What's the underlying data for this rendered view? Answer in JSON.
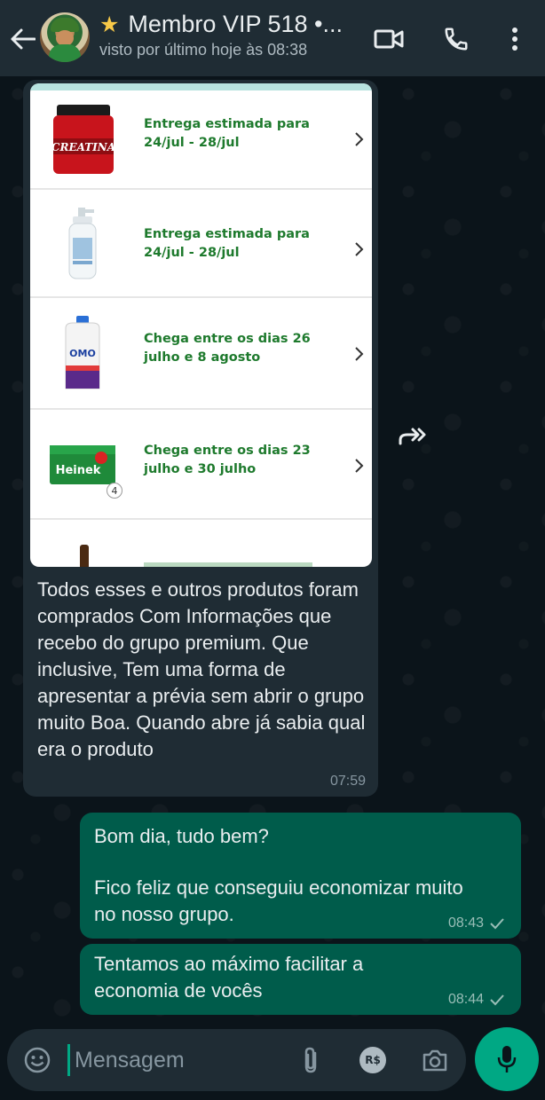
{
  "header": {
    "title": "Membro VIP 518 •...",
    "title_icon": "star-icon",
    "last_seen": "visto por último hoje às 08:38",
    "icons": [
      "back-arrow-icon",
      "video-call-icon",
      "phone-call-icon",
      "more-vert-icon"
    ]
  },
  "chat": {
    "incoming": {
      "products": [
        {
          "thumb": "creatina-product-icon",
          "thumb_label": "CREATINA",
          "text": "Entrega estimada para 24/jul - 28/jul"
        },
        {
          "thumb": "lotion-bottle-icon",
          "thumb_label": "",
          "text": "Entrega estimada para 24/jul - 28/jul"
        },
        {
          "thumb": "omo-detergent-icon",
          "thumb_label": "OMO",
          "text": "Chega entre os dias 26 julho e 8 agosto"
        },
        {
          "thumb": "heineken-pack-icon",
          "thumb_label": "Heinek",
          "badge": "4",
          "text": "Chega entre os dias 23 julho e 30 julho"
        }
      ],
      "text": "Todos esses e outros produtos foram comprados Com Informações que recebo do grupo premium. Que inclusive, Tem uma forma de apresentar a prévia sem abrir o grupo muito Boa. Quando abre já sabia qual era o produto",
      "time": "07:59"
    },
    "outgoing": [
      {
        "line1": "Bom dia, tudo bem?",
        "line2": "Fico feliz que conseguiu economizar muito no nosso grupo.",
        "time": "08:43"
      },
      {
        "line1": "Tentamos ao máximo facilitar a economia de vocês",
        "time": "08:44"
      }
    ]
  },
  "composer": {
    "placeholder": "Mensagem",
    "icons": [
      "emoji-icon",
      "attach-icon",
      "pix-payment-icon",
      "camera-icon",
      "mic-icon"
    ],
    "rs_label": "R$"
  },
  "colors": {
    "header_bg": "#1f2c34",
    "chat_bg": "#0b141a",
    "incoming_bg": "#1f2c34",
    "outgoing_bg": "#005c4b",
    "accent": "#00a884",
    "product_text": "#1e7a2d"
  }
}
